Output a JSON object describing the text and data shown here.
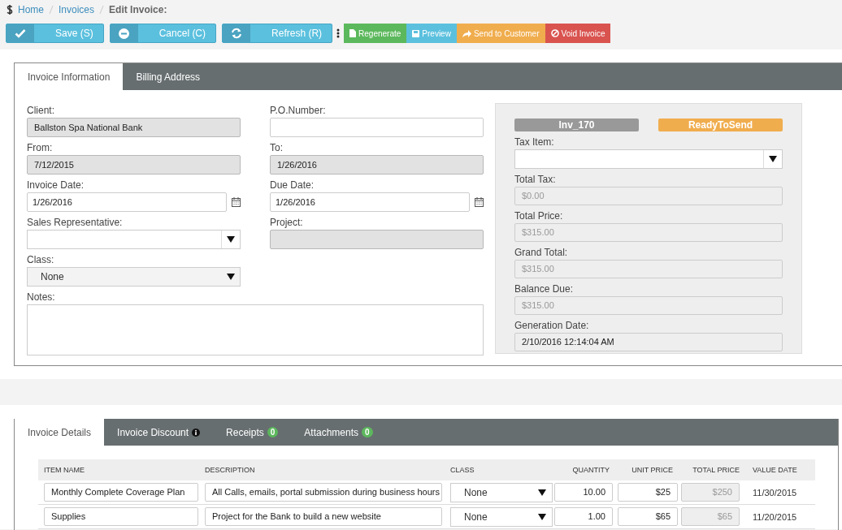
{
  "breadcrumb": {
    "items": [
      {
        "label": "Home"
      },
      {
        "label": "Invoices"
      }
    ],
    "current": "Edit Invoice:"
  },
  "toolbar": {
    "split_buttons": [
      {
        "label": "Save (S)"
      },
      {
        "label": "Cancel (C)"
      },
      {
        "label": "Refresh (R)"
      }
    ],
    "actions": [
      {
        "label": "Regenerate",
        "color": "#5cb85c"
      },
      {
        "label": "Preview",
        "color": "#5bc0de"
      },
      {
        "label": "Send to Customer",
        "color": "#f0ad4e"
      },
      {
        "label": "Void Invoice",
        "color": "#d9534f"
      }
    ]
  },
  "info_tabs": [
    {
      "label": "Invoice Information",
      "selected": true
    },
    {
      "label": "Billing Address",
      "selected": false
    }
  ],
  "left_fields": [
    {
      "label": "Client:",
      "kind": "text",
      "value": "Ballston Spa National Bank",
      "disabled": true
    },
    {
      "label": "From:",
      "kind": "text",
      "value": "7/12/2015",
      "disabled": true
    },
    {
      "label": "Invoice Date:",
      "kind": "date",
      "value": "1/26/2016",
      "disabled": false
    },
    {
      "label": "Sales Representative:",
      "kind": "select",
      "disabled": false
    },
    {
      "label": "Class:",
      "kind": "select",
      "value": "None",
      "disabled": true
    }
  ],
  "right_fields": [
    {
      "label": "P.O.Number:",
      "kind": "text",
      "disabled": false
    },
    {
      "label": "To:",
      "kind": "text",
      "value": "1/26/2016",
      "disabled": true
    },
    {
      "label": "Due Date:",
      "kind": "date",
      "value": "1/26/2016",
      "disabled": false
    },
    {
      "label": "Project:",
      "kind": "text",
      "disabled": true
    }
  ],
  "notes": {
    "label": "Notes:"
  },
  "summary": {
    "badges": [
      {
        "text": "Inv_170",
        "color": "#999999"
      },
      {
        "text": "ReadyToSend",
        "color": "#f0ad4e"
      }
    ],
    "fields": [
      {
        "label": "Tax Item:",
        "kind": "select"
      },
      {
        "label": "Total Tax:",
        "kind": "text",
        "value": "$0.00",
        "disabled": true
      },
      {
        "label": "Total Price:",
        "kind": "text",
        "value": "$315.00",
        "disabled": true
      },
      {
        "label": "Grand Total:",
        "kind": "text",
        "value": "$315.00",
        "disabled": true
      },
      {
        "label": "Balance Due:",
        "kind": "text",
        "value": "$315.00",
        "disabled": true
      },
      {
        "label": "Generation Date:",
        "kind": "text",
        "value": "2/10/2016 12:14:04 AM",
        "disabled": false
      }
    ]
  },
  "detail_tabs": [
    {
      "label": "Invoice Details",
      "selected": true,
      "info": false
    },
    {
      "label": "Invoice Discount",
      "selected": false,
      "info": true
    },
    {
      "label": "Receipts",
      "selected": false,
      "info": false,
      "count": "0"
    },
    {
      "label": "Attachments",
      "selected": false,
      "info": false,
      "count": "0"
    }
  ],
  "table": {
    "columns": [
      "ITEM NAME",
      "DESCRIPTION",
      "CLASS",
      "QUANTITY",
      "UNIT PRICE",
      "TOTAL PRICE",
      "VALUE DATE"
    ],
    "rows": [
      {
        "item_name": "Monthly Complete Coverage Plan",
        "description": "All Calls, emails, portal submission during business hours",
        "class": "None",
        "quantity": "10.00",
        "unit_price": "$25",
        "total_price": "$250",
        "value_date": "11/30/2015"
      },
      {
        "item_name": "Supplies",
        "description": "Project for the Bank to build a new website",
        "class": "None",
        "quantity": "1.00",
        "unit_price": "$65",
        "total_price": "$65",
        "value_date": "11/20/2015"
      }
    ]
  }
}
